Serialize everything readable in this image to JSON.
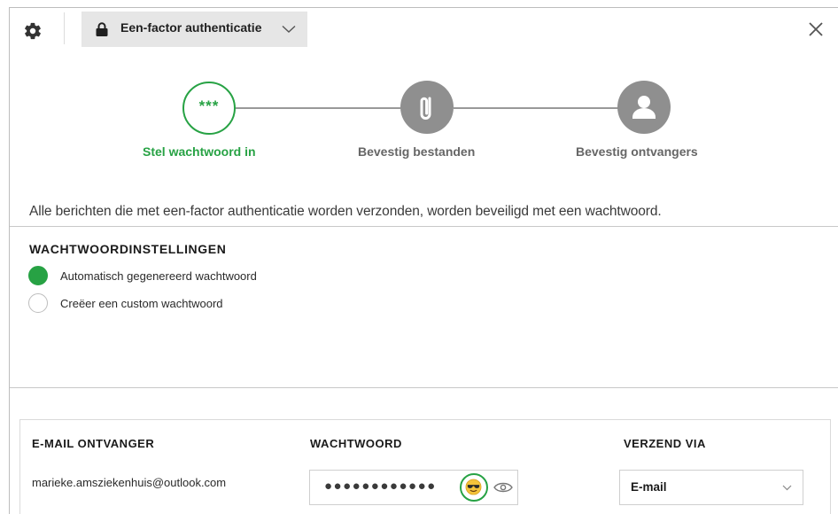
{
  "header": {
    "mode_label": "Een-factor authenticatie",
    "icons": [
      "gear-icon",
      "lock-icon",
      "chevron-down-icon",
      "close-icon"
    ]
  },
  "stepper": {
    "steps": [
      {
        "label": "Stel wachtwoord in",
        "icon": "password-dots-icon",
        "state": "active",
        "glyph": "***"
      },
      {
        "label": "Bevestig bestanden",
        "icon": "paperclip-icon",
        "state": "pending"
      },
      {
        "label": "Bevestig ontvangers",
        "icon": "user-icon",
        "state": "pending"
      }
    ]
  },
  "intro_text": "Alle berichten die met een-factor authenticatie worden verzonden, worden beveiligd met een wachtwoord.",
  "settings": {
    "title": "WACHTWOORDINSTELLINGEN",
    "options": [
      {
        "label": "Automatisch gegenereerd wachtwoord",
        "selected": true
      },
      {
        "label": "Creëer een custom wachtwoord",
        "selected": false
      }
    ]
  },
  "recipients": {
    "headers": {
      "email": "E-MAIL ONTVANGER",
      "password": "WACHTWOORD",
      "send_via": "VERZEND VIA"
    },
    "rows": [
      {
        "email": "marieke.amsziekenhuis@outlook.com",
        "password_masked": "●●●●●●●●●●●●",
        "send_via": "E-mail"
      }
    ]
  },
  "colors": {
    "accent": "#27a244",
    "pending": "#8f8f8f",
    "select_bg": "#e6e6e6"
  }
}
